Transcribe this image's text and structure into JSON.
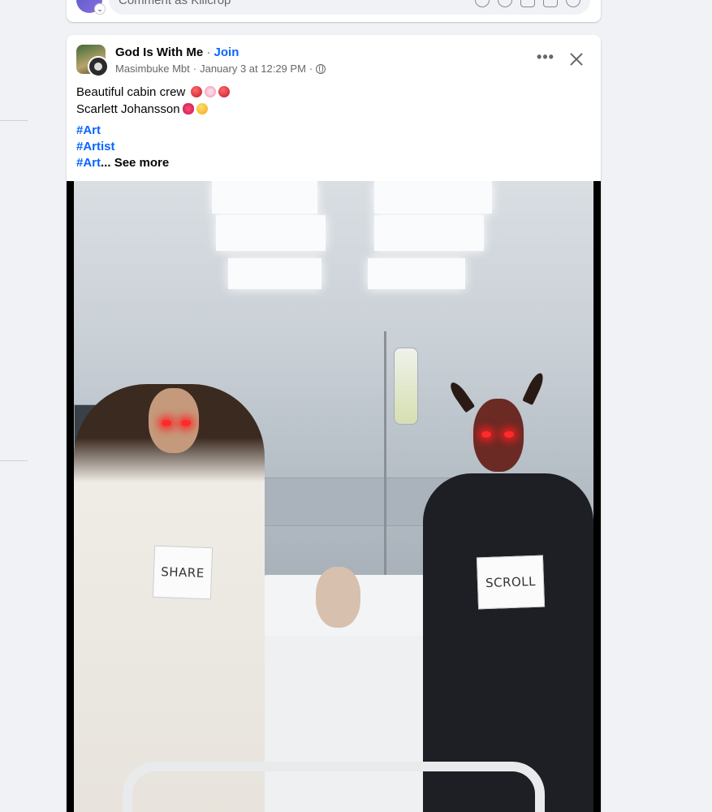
{
  "previous_post": {
    "comment_placeholder": "Comment as Kilicrop",
    "icons": [
      "avatar-sticker-icon",
      "emoji-icon",
      "camera-icon",
      "gif-icon",
      "sticker-icon"
    ]
  },
  "post": {
    "group_name": "God Is With Me",
    "separator": "·",
    "join_label": "Join",
    "author": "Masimbuke Mbt",
    "timestamp": "January 3 at 12:29 PM",
    "meta_separator": "·",
    "audience_icon": "globe-icon",
    "text_line1": "Beautiful cabin crew",
    "text_line2": "Scarlett Johansson",
    "hashtags": [
      "#Art",
      "#Artist",
      "#Art"
    ],
    "ellipsis": "...",
    "see_more": "See more",
    "image": {
      "sign_left": "SHARE",
      "sign_right": "SCROLL"
    }
  },
  "colors": {
    "link_blue": "#0866ff",
    "secondary_text": "#65676b",
    "background": "#f0f2f5"
  }
}
